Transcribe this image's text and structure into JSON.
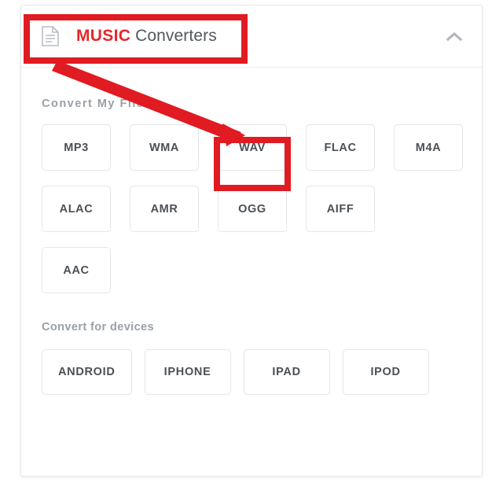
{
  "card": {
    "header": {
      "icon": "document-icon",
      "brand_text": "MUSIC",
      "title_rest": " Converters",
      "collapse_icon": "chevron-up-icon"
    },
    "sections": [
      {
        "label": "Convert My File To",
        "rows": [
          [
            "MP3",
            "WMA",
            "WAV",
            "FLAC",
            "M4A"
          ],
          [
            "ALAC",
            "AMR",
            "OGG",
            "AIFF"
          ],
          [
            "AAC"
          ]
        ]
      },
      {
        "label": "Convert for devices",
        "rows": [
          [
            "ANDROID",
            "IPHONE",
            "IPAD",
            "IPOD"
          ]
        ]
      }
    ]
  },
  "annotations": {
    "highlight_color": "#e01b22",
    "highlighted_header": "MUSIC Converters",
    "highlighted_button": "WAV",
    "arrow": "points from MUSIC Converters header to the WAV button"
  },
  "colors": {
    "brand_red": "#e8262b",
    "annotation_red": "#e01b22",
    "label_gray": "#9aa0a6",
    "button_text": "#4a5056",
    "border": "#e4e6e8"
  }
}
